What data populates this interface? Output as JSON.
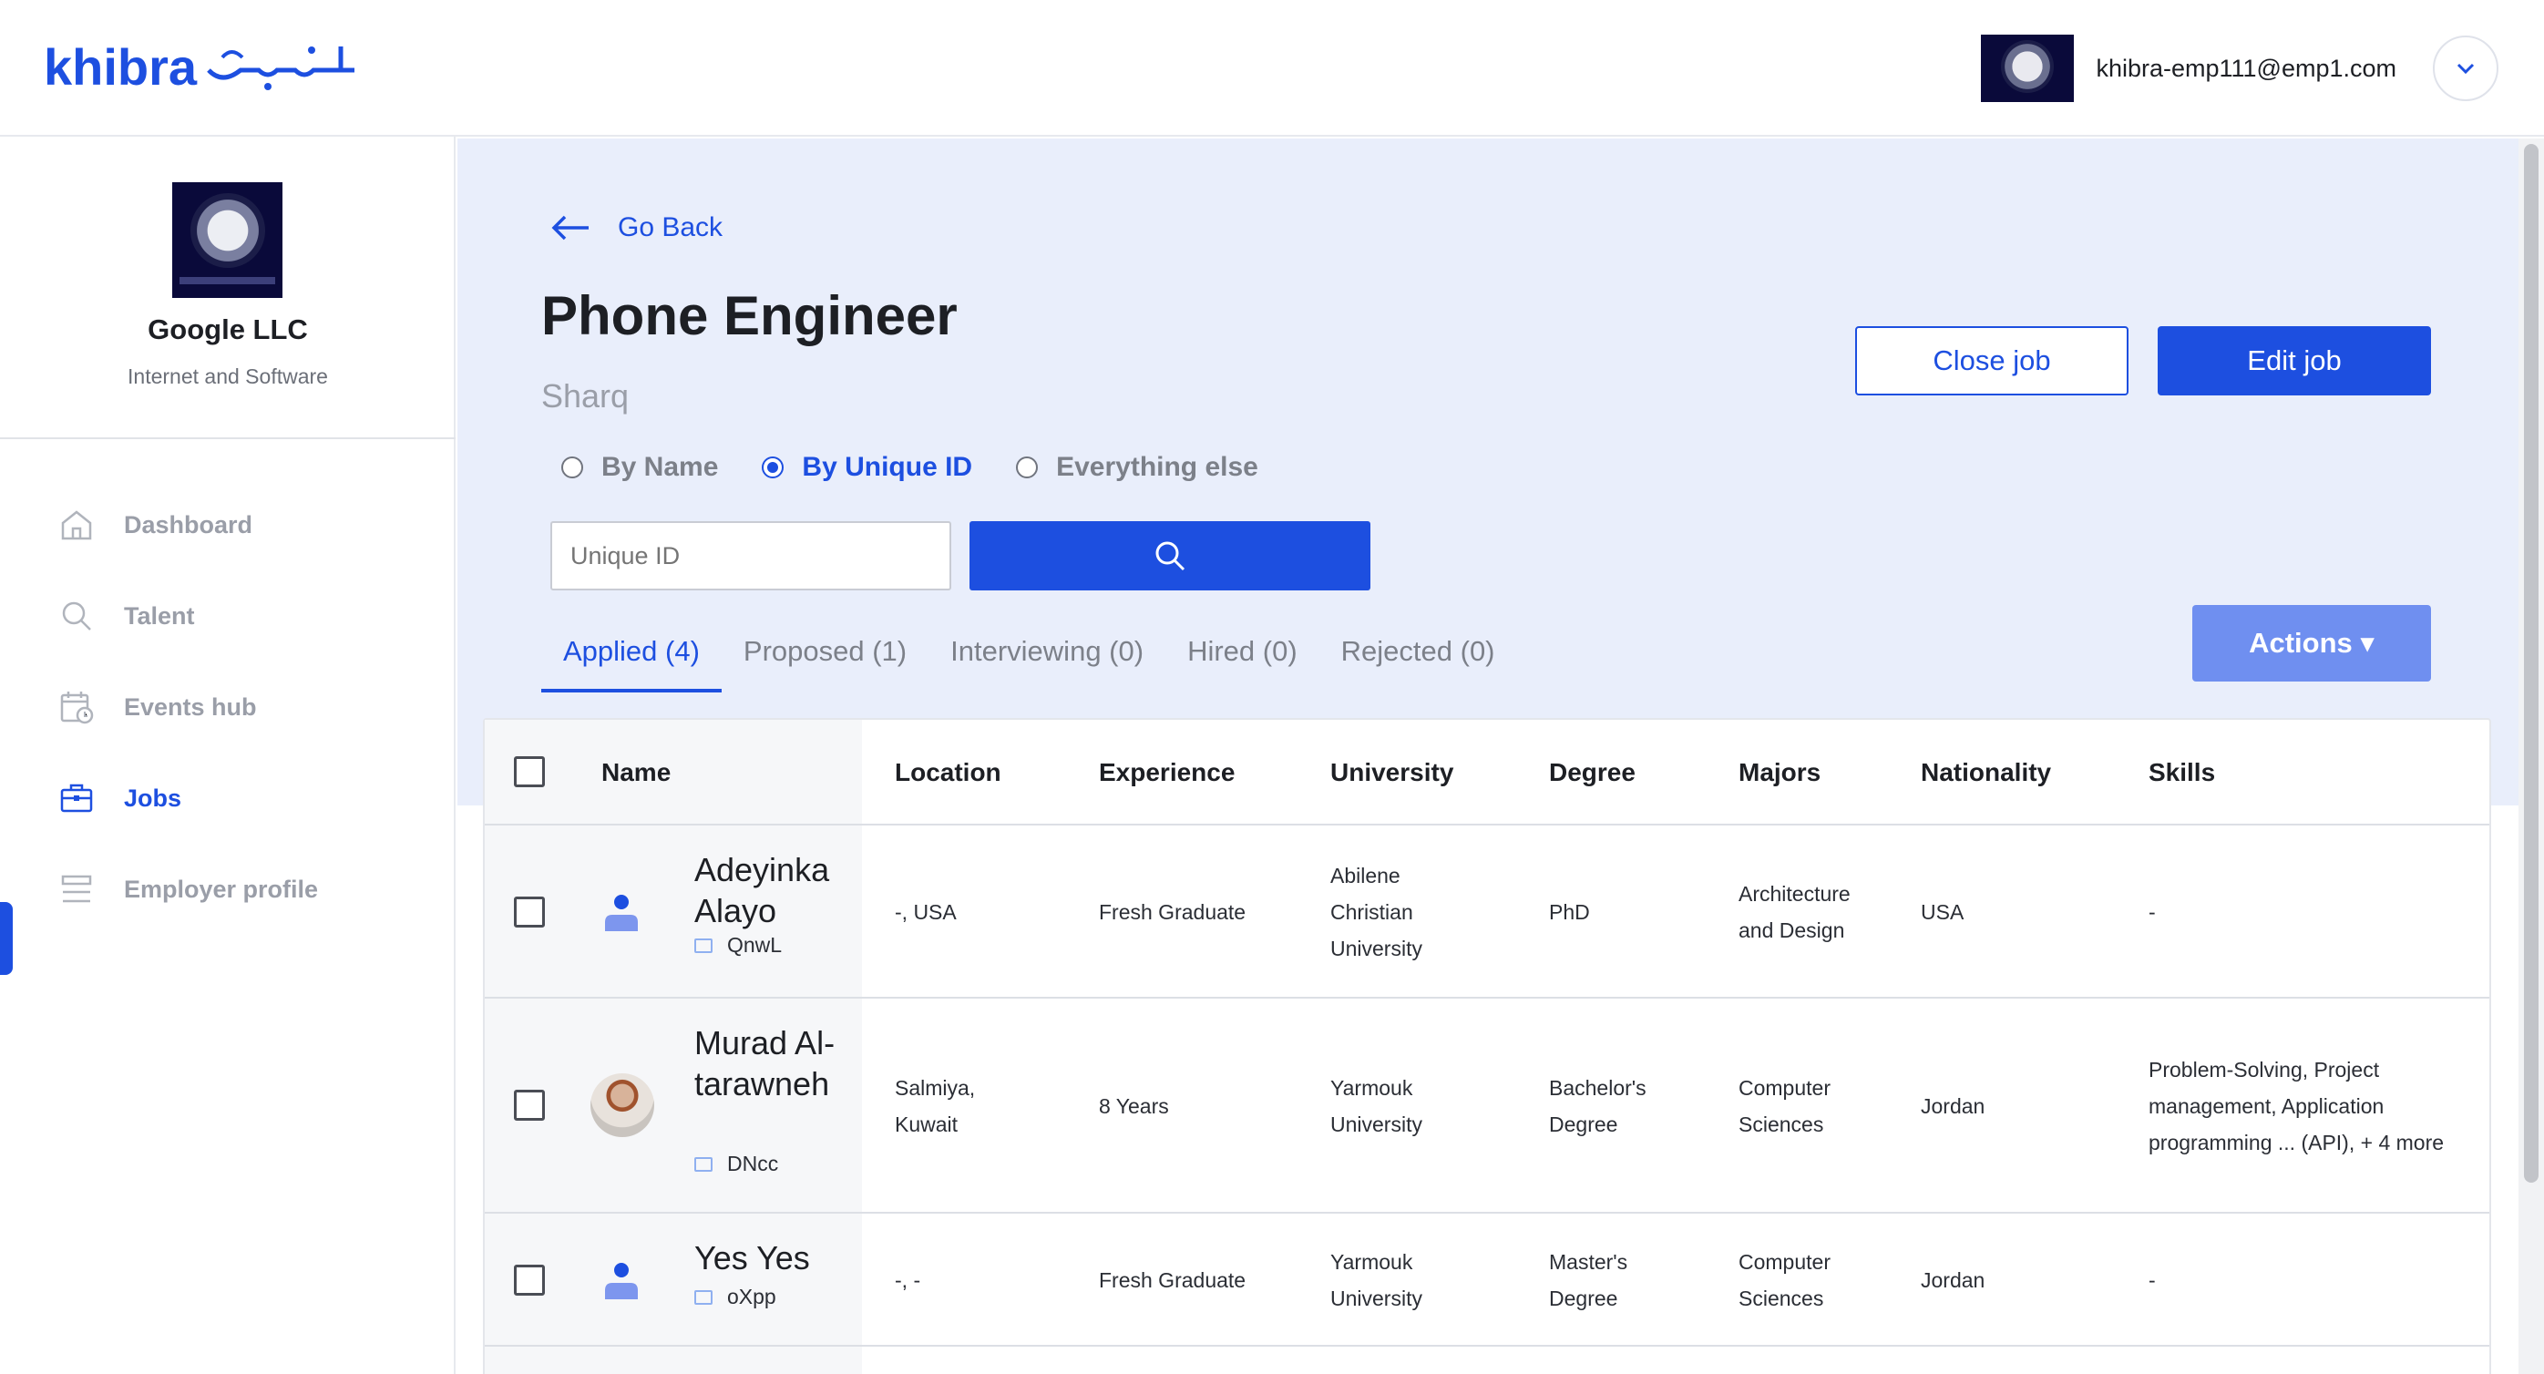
{
  "header": {
    "logo_text": "khibra",
    "logo_arabic": "خبرة",
    "user_email": "khibra-emp111@emp1.com"
  },
  "sidebar": {
    "company_name": "Google LLC",
    "company_industry": "Internet and Software",
    "items": [
      {
        "label": "Dashboard",
        "icon": "home-icon",
        "active": false
      },
      {
        "label": "Talent",
        "icon": "search-icon",
        "active": false
      },
      {
        "label": "Events hub",
        "icon": "calendar-icon",
        "active": false
      },
      {
        "label": "Jobs",
        "icon": "briefcase-icon",
        "active": true
      },
      {
        "label": "Employer profile",
        "icon": "profile-list-icon",
        "active": false
      }
    ]
  },
  "main": {
    "go_back": "Go Back",
    "job_title": "Phone Engineer",
    "job_location": "Sharq",
    "close_job": "Close job",
    "edit_job": "Edit job",
    "search_modes": [
      {
        "label": "By Name",
        "checked": false
      },
      {
        "label": "By Unique ID",
        "checked": true
      },
      {
        "label": "Everything else",
        "checked": false
      }
    ],
    "search_placeholder": "Unique ID",
    "tabs": [
      {
        "label": "Applied (4)",
        "active": true
      },
      {
        "label": "Proposed (1)",
        "active": false
      },
      {
        "label": "Interviewing (0)",
        "active": false
      },
      {
        "label": "Hired (0)",
        "active": false
      },
      {
        "label": "Rejected (0)",
        "active": false
      }
    ],
    "actions_label": "Actions ▾"
  },
  "table": {
    "columns": [
      "Name",
      "Location",
      "Experience",
      "University",
      "Degree",
      "Majors",
      "Nationality",
      "Skills"
    ],
    "rows": [
      {
        "name": "Adeyinka Alayo",
        "id": "QnwL",
        "avatar": "default",
        "location": "-, USA",
        "experience": "Fresh Graduate",
        "university": "Abilene Christian University",
        "degree": "PhD",
        "majors": "Architecture and Design",
        "nationality": "USA",
        "skills": "-"
      },
      {
        "name": "Murad Al-tarawneh",
        "id": "DNcc",
        "avatar": "photo",
        "location": "Salmiya, Kuwait",
        "experience": "8 Years",
        "university": "Yarmouk University",
        "degree": "Bachelor's Degree",
        "majors": "Computer Sciences",
        "nationality": "Jordan",
        "skills": "Problem-Solving, Project management, Application programming ... (API), + 4 more"
      },
      {
        "name": "Yes Yes",
        "id": "oXpp",
        "avatar": "default",
        "location": "-, -",
        "experience": "Fresh Graduate",
        "university": "Yarmouk University",
        "degree": "Master's Degree",
        "majors": "Computer Sciences",
        "nationality": "Jordan",
        "skills": "-"
      }
    ]
  },
  "colors": {
    "primary": "#1d4fe0",
    "actions_button": "#6f8ff0",
    "main_background": "#e9eefb",
    "muted_text": "#9a9ea8"
  }
}
